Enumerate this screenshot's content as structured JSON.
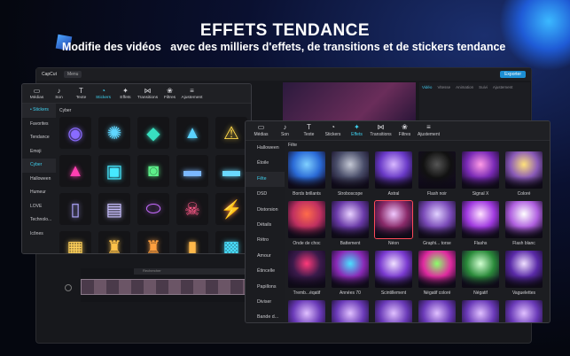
{
  "headline": "EFFETS TENDANCE",
  "subheadline": "Modifie des vidéos   avec des milliers d'effets, de transitions et de stickers tendance",
  "background_editor": {
    "app_name": "CapCut",
    "menu_label": "Menu",
    "export_label": "Exporter",
    "timeline_search_placeholder": "Rechercher",
    "property_tabs": [
      "Vidéo",
      "Vitesse",
      "Animation",
      "Suivi",
      "Ajustement"
    ]
  },
  "toolbar_items": [
    {
      "label": "Médias",
      "icon": "media-icon"
    },
    {
      "label": "Son",
      "icon": "audio-icon"
    },
    {
      "label": "Texte",
      "icon": "text-icon"
    },
    {
      "label": "Stickers",
      "icon": "sticker-icon"
    },
    {
      "label": "Effets",
      "icon": "effects-icon"
    },
    {
      "label": "Transitions",
      "icon": "transitions-icon"
    },
    {
      "label": "Filtres",
      "icon": "filters-icon"
    },
    {
      "label": "Ajustement",
      "icon": "adjust-icon"
    }
  ],
  "stickers_panel": {
    "active_tool": "Stickers",
    "sidebar": [
      "• Stickers",
      "Favorites",
      "Tendance",
      "Emoji",
      "Cyber",
      "Halloween",
      "Humeur",
      "LOVE",
      "Technolo...",
      "Icônes"
    ],
    "active_category": "Cyber",
    "category_label": "Cyber",
    "stickers": [
      {
        "icon": "neon-globe-icon",
        "color": "#8a6bff"
      },
      {
        "icon": "neon-rave-icon",
        "color": "#5fd6ff"
      },
      {
        "icon": "neon-diamond-icon",
        "color": "#38e0c0"
      },
      {
        "icon": "neon-triangle-icon",
        "color": "#5ad2ff"
      },
      {
        "icon": "neon-triangle-warning-icon",
        "color": "#ffd84a"
      },
      {
        "icon": "neon-triangle-icon",
        "color": "#ff3fb0"
      },
      {
        "icon": "neon-sign-icon",
        "color": "#46e8ff"
      },
      {
        "icon": "neon-badge-icon",
        "color": "#5df08a"
      },
      {
        "icon": "neon-bar-icon",
        "color": "#7bb8ff"
      },
      {
        "icon": "neon-bar-icon",
        "color": "#6ad8ff"
      },
      {
        "icon": "neon-tube-icon",
        "color": "#b0a8ff"
      },
      {
        "icon": "neon-box-icon",
        "color": "#c9c0ff"
      },
      {
        "icon": "neon-pill-icon",
        "color": "#c66bff"
      },
      {
        "icon": "neon-skull-icon",
        "color": "#ff5a8a"
      },
      {
        "icon": "neon-bolt-icon",
        "color": "#ff8a3f"
      },
      {
        "icon": "neon-arcade-icon",
        "color": "#ffd05a"
      },
      {
        "icon": "neon-lantern-icon",
        "color": "#ffc24a"
      },
      {
        "icon": "neon-lantern-icon",
        "color": "#ff9f3f"
      },
      {
        "icon": "neon-can-icon",
        "color": "#ffb84a"
      },
      {
        "icon": "neon-chip-icon",
        "color": "#4ae0ff"
      }
    ]
  },
  "effects_panel": {
    "active_tool": "Effets",
    "sidebar": [
      "Halloween",
      "Étoile",
      "Fête",
      "DSD",
      "Distorsion",
      "Détails",
      "Rétro",
      "Amour",
      "Étincelle",
      "Papillons",
      "Diviser",
      "Bande d..."
    ],
    "active_category": "Fête",
    "category_label": "Fête",
    "effects": [
      {
        "label": "Bords brillants"
      },
      {
        "label": "Stroboscope"
      },
      {
        "label": "Astral"
      },
      {
        "label": "Flash noir"
      },
      {
        "label": "Signal X"
      },
      {
        "label": "Coloré"
      },
      {
        "label": "Onde de choc"
      },
      {
        "label": "Battement"
      },
      {
        "label": "Néon",
        "selected": true
      },
      {
        "label": "Graphi... torse"
      },
      {
        "label": "Flashs"
      },
      {
        "label": "Flash blanc"
      },
      {
        "label": "Tremb...éqatif"
      },
      {
        "label": "Années 70"
      },
      {
        "label": "Scintillement"
      },
      {
        "label": "Négatif coloré"
      },
      {
        "label": "Négatif"
      },
      {
        "label": "Vaguelettes"
      },
      {
        "label": ""
      },
      {
        "label": ""
      },
      {
        "label": ""
      },
      {
        "label": ""
      },
      {
        "label": ""
      },
      {
        "label": ""
      }
    ]
  }
}
